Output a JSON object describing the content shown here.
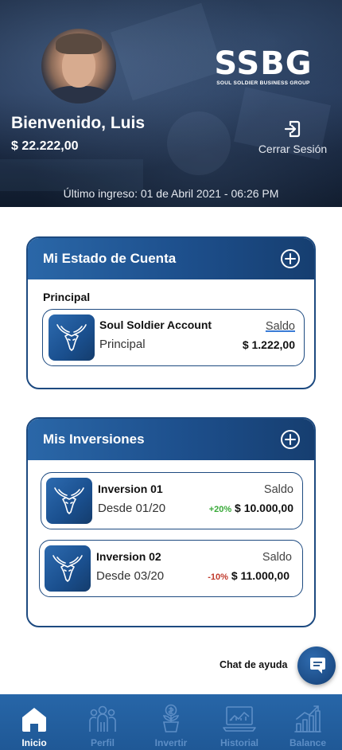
{
  "header": {
    "brand_big": "SSBG",
    "brand_small": "SOUL SOLDIER BUSINESS GROUP",
    "welcome": "Bienvenido, Luis",
    "balance": "$ 22.222,00",
    "logout_label": "Cerrar Sesión",
    "last_login": "Último ingreso: 01 de Abril 2021 - 06:26 PM"
  },
  "estado": {
    "title": "Mi Estado de Cuenta",
    "section": "Principal",
    "account": {
      "name": "Soul Soldier Account",
      "sub": "Principal",
      "saldo_label": "Saldo",
      "amount": "$ 1.222,00"
    }
  },
  "inversiones": {
    "title": "Mis Inversiones",
    "items": [
      {
        "name": "Inversion 01",
        "since": "Desde 01/20",
        "saldo_label": "Saldo",
        "pct": "+20%",
        "amount": "$ 10.000,00",
        "trend": "up"
      },
      {
        "name": "Inversion 02",
        "since": "Desde 03/20",
        "saldo_label": "Saldo",
        "pct": "-10%",
        "amount": "$ 11.000,00",
        "trend": "down"
      }
    ]
  },
  "chat": {
    "label": "Chat de ayuda"
  },
  "nav": {
    "items": [
      {
        "label": "Inicio",
        "icon": "home-icon",
        "active": true
      },
      {
        "label": "Perfil",
        "icon": "people-icon",
        "active": false
      },
      {
        "label": "Invertir",
        "icon": "invest-plant-icon",
        "active": false
      },
      {
        "label": "Historial",
        "icon": "laptop-chart-icon",
        "active": false
      },
      {
        "label": "Balance",
        "icon": "bar-chart-icon",
        "active": false
      }
    ]
  },
  "colors": {
    "brand_blue": "#1d4a80",
    "nav_blue": "#2766a8",
    "positive": "#3aaa3a",
    "negative": "#c0392b"
  }
}
